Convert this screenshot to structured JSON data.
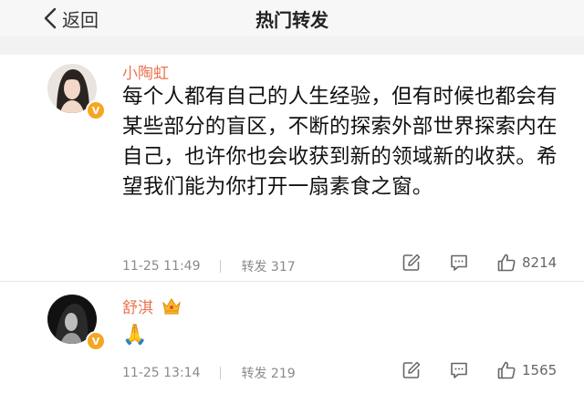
{
  "nav": {
    "back_label": "返回",
    "title": "热门转发"
  },
  "posts": [
    {
      "author": "小陶虹",
      "content": "每个人都有自己的人生经验，但有时候也都会有某些部分的盲区，不断的探索外部世界探索内在自己，也许你也会收获到新的领域新的收获。希望我们能为你打开一扇素食之窗。",
      "time": "11-25 11:49",
      "repost": "转发 317",
      "likes": "8214"
    },
    {
      "author": "舒淇",
      "content": "🙏",
      "time": "11-25 13:14",
      "repost": "转发 219",
      "likes": "1565"
    }
  ],
  "colors": {
    "name": "#eb7350",
    "badge": "#f5a623",
    "meta": "#8a8a8a"
  }
}
